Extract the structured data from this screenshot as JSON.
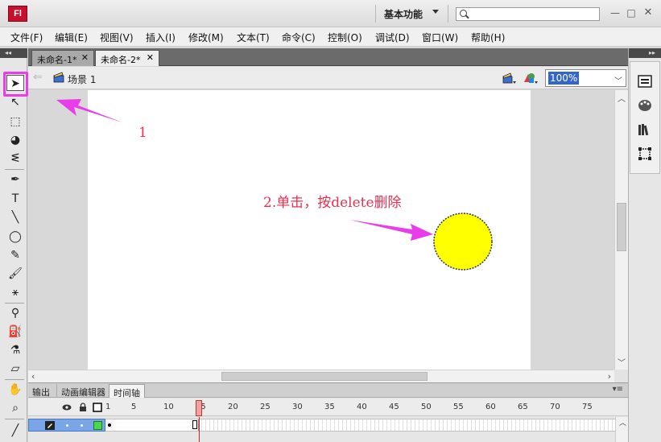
{
  "app": {
    "logo_text": "Fl",
    "workspace": "基本功能",
    "search_placeholder": "",
    "window_controls": {
      "minimize": "—",
      "maximize": "□",
      "close": "✕"
    }
  },
  "menu": [
    "文件(F)",
    "编辑(E)",
    "视图(V)",
    "插入(I)",
    "修改(M)",
    "文本(T)",
    "命令(C)",
    "控制(O)",
    "调试(D)",
    "窗口(W)",
    "帮助(H)"
  ],
  "doc_tabs": [
    {
      "label": "未命名-1*",
      "active": false
    },
    {
      "label": "未命名-2*",
      "active": true
    }
  ],
  "scene": {
    "label": "场景 1",
    "zoom": "100%"
  },
  "annotations": {
    "step1": "1",
    "step2": "2.单击，按delete删除"
  },
  "annotation_color": "#e8304f",
  "arrow_color": "#e83de8",
  "stage_object": {
    "shape": "circle",
    "fill": "#ffff00",
    "outline": "#333333"
  },
  "tools": [
    {
      "icon": "selection-arrow-icon",
      "glyph": "➤"
    },
    {
      "icon": "subselection-arrow-icon",
      "glyph": "↖"
    },
    {
      "icon": "free-transform-icon",
      "glyph": "⬚"
    },
    {
      "icon": "3d-rotation-icon",
      "glyph": "◕"
    },
    {
      "icon": "lasso-icon",
      "glyph": "ᓬ"
    },
    {
      "icon": "pen-icon",
      "glyph": "✒"
    },
    {
      "icon": "text-icon",
      "glyph": "T"
    },
    {
      "icon": "line-icon",
      "glyph": "╲"
    },
    {
      "icon": "oval-icon",
      "glyph": "◯"
    },
    {
      "icon": "pencil-icon",
      "glyph": "✎"
    },
    {
      "icon": "brush-icon",
      "glyph": "🖌"
    },
    {
      "icon": "deco-icon",
      "glyph": "⚹"
    },
    {
      "icon": "bone-icon",
      "glyph": "⚲"
    },
    {
      "icon": "paint-bucket-icon",
      "glyph": "⛽"
    },
    {
      "icon": "eyedropper-icon",
      "glyph": "⚗"
    },
    {
      "icon": "eraser-icon",
      "glyph": "▱"
    },
    {
      "icon": "hand-icon",
      "glyph": "✋"
    },
    {
      "icon": "zoom-icon",
      "glyph": "⌕"
    },
    {
      "icon": "stroke-color-icon",
      "glyph": "╱"
    }
  ],
  "panel_tabs": [
    "输出",
    "动画编辑器",
    "时间轴"
  ],
  "timeline": {
    "frame_numbers": [
      "1",
      "5",
      "10",
      "15",
      "20",
      "25",
      "30",
      "35",
      "40",
      "45",
      "50",
      "55",
      "60",
      "65",
      "70",
      "75"
    ],
    "current_frame": "15"
  }
}
